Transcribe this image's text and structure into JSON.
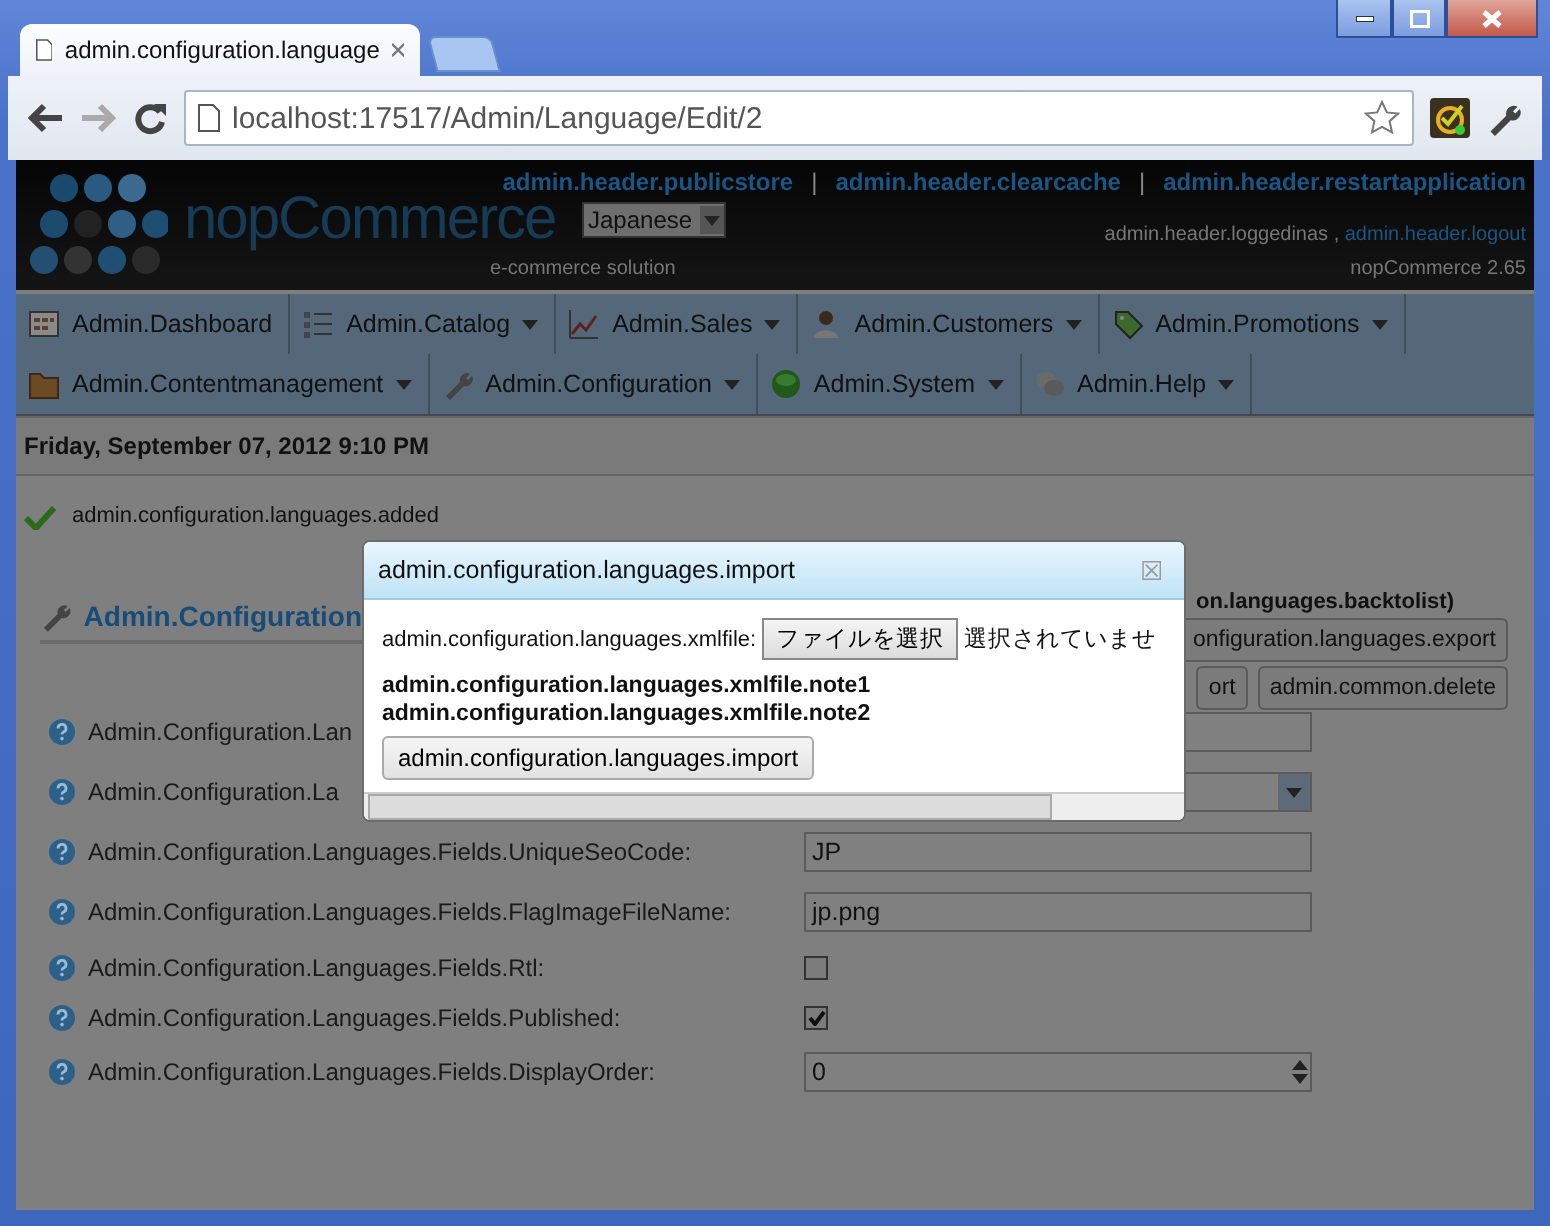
{
  "browser": {
    "tab": {
      "title": "admin.configuration.language",
      "selected": true
    },
    "address": "localhost:17517/Admin/Language/Edit/2"
  },
  "header": {
    "nav": [
      {
        "kind": "link",
        "text": "admin.header.publicstore"
      },
      {
        "kind": "separator",
        "text": "|"
      },
      {
        "kind": "link",
        "text": "admin.header.clearcache"
      },
      {
        "kind": "separator",
        "text": "|"
      },
      {
        "kind": "link",
        "text": "admin.header.restartapplication"
      }
    ],
    "language_select": "Japanese",
    "logo": "nopCommerce",
    "tagline": "e-commerce solution",
    "logged_in_as": "admin.header.loggedinas ,",
    "logout": "admin.header.logout",
    "version": "nopCommerce 2.65"
  },
  "menu": [
    [
      {
        "label": "Admin.Dashboard",
        "dropdown": false
      },
      {
        "label": "Admin.Catalog",
        "dropdown": true
      },
      {
        "label": "Admin.Sales",
        "dropdown": true
      },
      {
        "label": "Admin.Customers",
        "dropdown": true
      },
      {
        "label": "Admin.Promotions",
        "dropdown": true
      }
    ],
    [
      {
        "label": "Admin.Contentmanagement",
        "dropdown": true
      },
      {
        "label": "Admin.Configuration",
        "dropdown": true
      },
      {
        "label": "Admin.System",
        "dropdown": true
      },
      {
        "label": "Admin.Help",
        "dropdown": true
      }
    ]
  ],
  "date": "Friday, September 07, 2012 9:10 PM",
  "message": "admin.configuration.languages.added",
  "page_title": "Admin.Configuration",
  "back_link": "on.languages.backtolist)",
  "button_rows": [
    [
      "onfiguration.languages.export"
    ],
    [
      "ort",
      "admin.common.delete"
    ]
  ],
  "fields": [
    {
      "label": "Admin.Configuration.Lan",
      "kind": "text"
    },
    {
      "label": "Admin.Configuration.La",
      "kind": "select"
    },
    {
      "label": "Admin.Configuration.Languages.Fields.UniqueSeoCode:",
      "kind": "text",
      "value": "JP"
    },
    {
      "label": "Admin.Configuration.Languages.Fields.FlagImageFileName:",
      "kind": "text",
      "value": "jp.png"
    },
    {
      "label": "Admin.Configuration.Languages.Fields.Rtl:",
      "kind": "checkbox",
      "checked": false
    },
    {
      "label": "Admin.Configuration.Languages.Fields.Published:",
      "kind": "checkbox",
      "checked": true
    },
    {
      "label": "Admin.Configuration.Languages.Fields.DisplayOrder:",
      "kind": "number",
      "value": "0"
    }
  ],
  "dialog": {
    "title": "admin.configuration.languages.import",
    "close": "☒",
    "file_label": "admin.configuration.languages.xmlfile:",
    "choose_button": "ファイルを選択",
    "no_file": "選択されていませ",
    "notes": [
      "admin.configuration.languages.xmlfile.note1",
      "admin.configuration.languages.xmlfile.note2"
    ],
    "import_button": "admin.configuration.languages.import"
  }
}
